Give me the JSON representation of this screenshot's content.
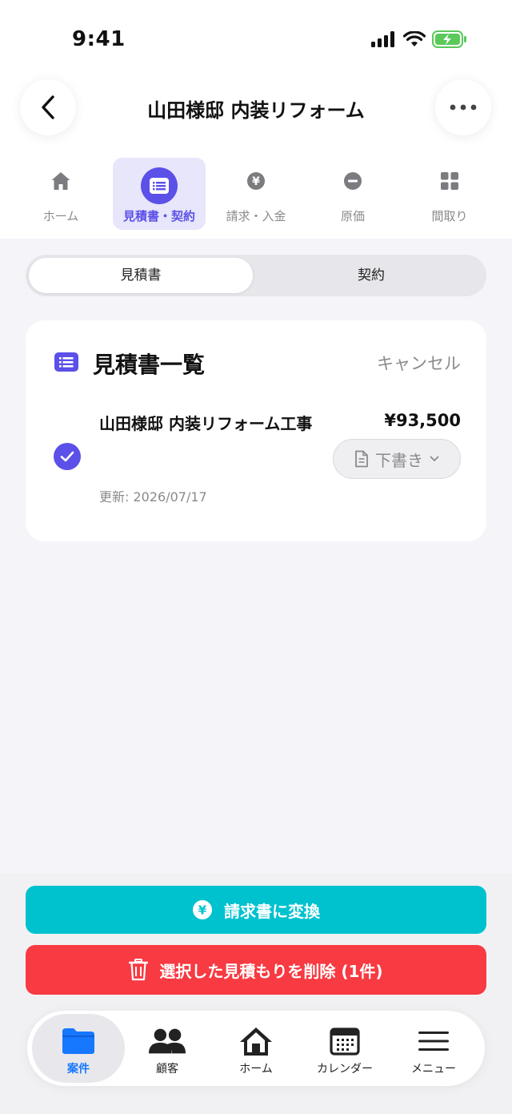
{
  "status_bar": {
    "time": "9:41"
  },
  "header": {
    "title": "山田様邸 内装リフォーム"
  },
  "tabs": [
    {
      "label": "ホーム",
      "icon": "house-icon"
    },
    {
      "label": "見積書・契約",
      "icon": "document-list-icon",
      "active": true
    },
    {
      "label": "請求・入金",
      "icon": "yen-icon"
    },
    {
      "label": "原価",
      "icon": "minus-circle-icon"
    },
    {
      "label": "間取り",
      "icon": "grid-icon"
    }
  ],
  "segment": {
    "options": [
      "見積書",
      "契約"
    ],
    "selected": "見積書"
  },
  "card": {
    "title": "見積書一覧",
    "cancel_label": "キャンセル",
    "estimate": {
      "name": "山田様邸 内装リフォーム工事",
      "amount": "¥93,500",
      "status": "下書き",
      "updated": "更新: 2026/07/17",
      "selected": true
    }
  },
  "actions": {
    "convert_label": "請求書に変換",
    "delete_label": "選択した見積もりを削除 (1件)"
  },
  "bottom_nav": [
    {
      "label": "案件",
      "icon": "folder-icon",
      "active": true
    },
    {
      "label": "顧客",
      "icon": "people-icon"
    },
    {
      "label": "ホーム",
      "icon": "house-icon"
    },
    {
      "label": "カレンダー",
      "icon": "calendar-icon"
    },
    {
      "label": "メニュー",
      "icon": "menu-icon"
    }
  ],
  "colors": {
    "accent": "#5b50e8",
    "convert": "#00c2cf",
    "delete": "#f83a42",
    "nav_active": "#1677ff"
  }
}
